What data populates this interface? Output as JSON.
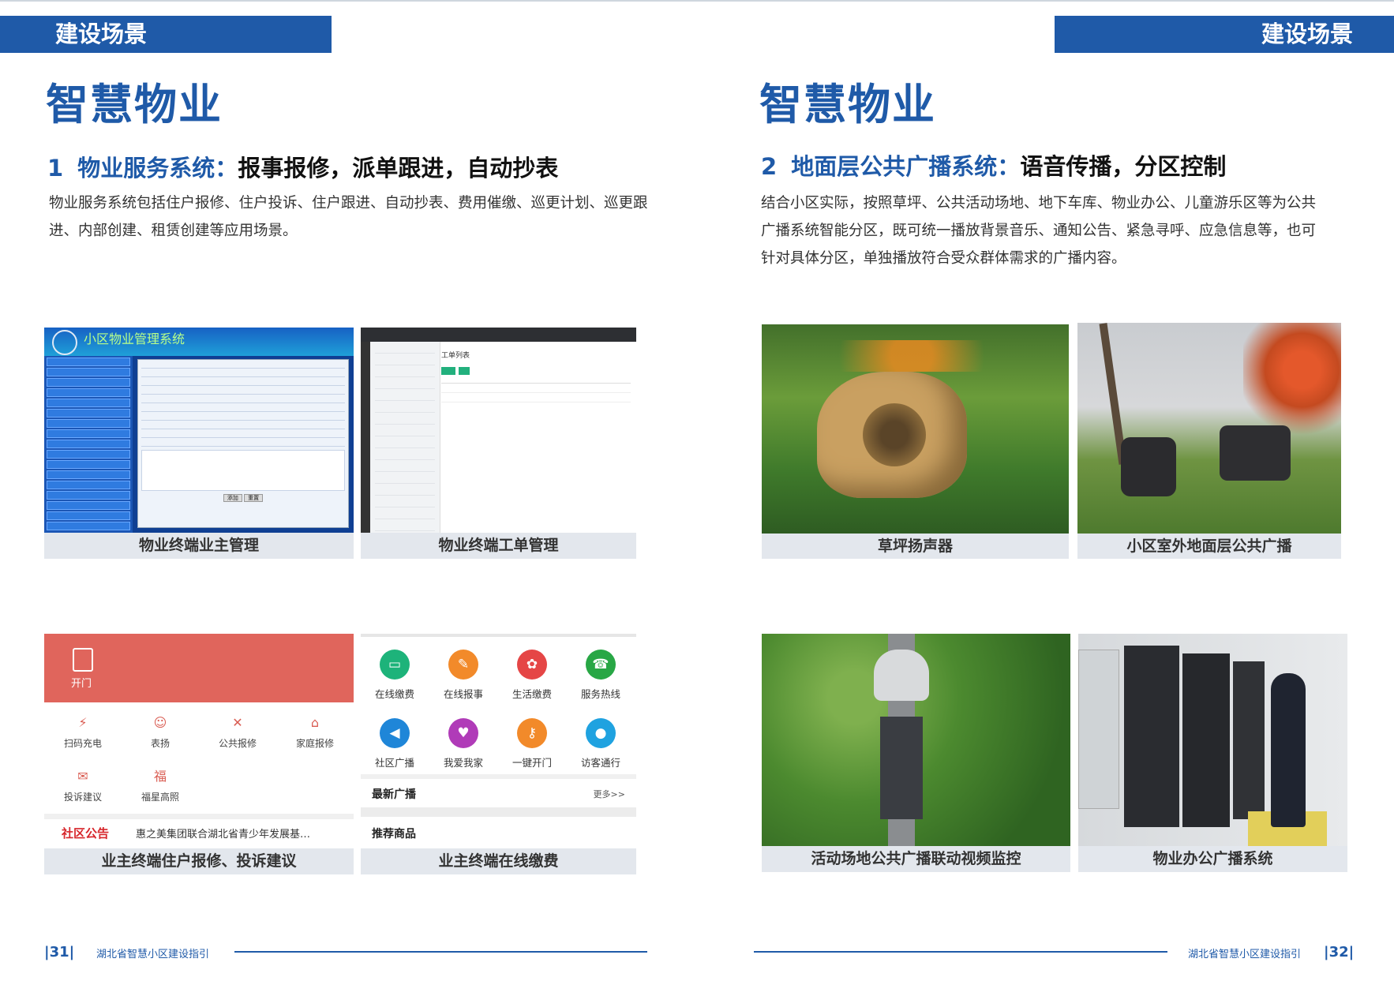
{
  "banner": {
    "left": "建设场景",
    "right": "建设场景"
  },
  "left_page": {
    "title": "智慧物业",
    "section_num": "1",
    "section_name": "物业服务系统：",
    "section_tagline": "报事报修，派单跟进，自动抄表",
    "paragraph": "物业服务系统包括住户报修、住户投诉、住户跟进、自动抄表、费用催缴、巡更计划、巡更跟进、内部创建、租赁创建等应用场景。",
    "captions": [
      "物业终端业主管理",
      "物业终端工单管理",
      "业主终端住户报修、投诉建议",
      "业主终端在线缴费"
    ],
    "page_number": "31",
    "footer_text": "湖北省智慧小区建设指引"
  },
  "right_page": {
    "title": "智慧物业",
    "section_num": "2",
    "section_name": "地面层公共广播系统：",
    "section_tagline": "语音传播，分区控制",
    "paragraph": "结合小区实际，按照草坪、公共活动场地、地下车库、物业办公、儿童游乐区等为公共广播系统智能分区，既可统一播放背景音乐、通知公告、紧急寻呼、应急信息等，也可针对具体分区，单独播放符合受众群体需求的广播内容。",
    "captions": [
      "草坪扬声器",
      "小区室外地面层公共广播",
      "活动场地公共广播联动视频监控",
      "物业办公广播系统"
    ],
    "page_number": "32",
    "footer_text": "湖北省智慧小区建设指引"
  },
  "screen1": {
    "title": "小区物业管理系统",
    "buttons": [
      "添加",
      "重置"
    ]
  },
  "screen2": {
    "title": "工单列表"
  },
  "app1": {
    "open_label": "开门",
    "items": [
      "扫码充电",
      "表扬",
      "公共报修",
      "家庭报修",
      "投诉建议",
      "福星高照"
    ],
    "notice_label": "社区公告",
    "notice_text": "惠之美集团联合湖北省青少年发展基…"
  },
  "app2": {
    "items": [
      "在线缴费",
      "在线报事",
      "生活缴费",
      "服务热线",
      "社区广播",
      "我爱我家",
      "一键开门",
      "访客通行"
    ],
    "latest_label": "最新广播",
    "more_label": "更多>>",
    "recommend_label": "推荐商品"
  },
  "colors": {
    "brand_blue": "#1f5aa8",
    "app_red": "#e0655c",
    "notice_red": "#d7262b"
  }
}
